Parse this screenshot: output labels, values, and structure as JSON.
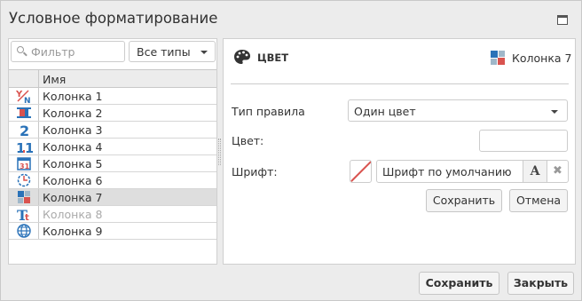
{
  "dialog": {
    "title": "Условное форматирование",
    "save_label": "Сохранить",
    "close_label": "Закрыть"
  },
  "left": {
    "filter_placeholder": "Фильтр",
    "type_select_value": "Все типы",
    "column_header": "Имя",
    "columns": [
      {
        "label": "Колонка 1",
        "icon": "text-yn-icon"
      },
      {
        "label": "Колонка 2",
        "icon": "bar-column-icon"
      },
      {
        "label": "Колонка 3",
        "icon": "number-2-icon"
      },
      {
        "label": "Колонка 4",
        "icon": "decimal-icon"
      },
      {
        "label": "Колонка 5",
        "icon": "calendar-icon"
      },
      {
        "label": "Колонка 6",
        "icon": "clock-icon"
      },
      {
        "label": "Колонка 7",
        "icon": "color-grid-icon",
        "selected": true
      },
      {
        "label": "Колонка 8",
        "icon": "text-type-icon",
        "disabled": true
      },
      {
        "label": "Колонка 9",
        "icon": "globe-icon"
      }
    ]
  },
  "right": {
    "header_title": "ЦВЕТ",
    "header_column": "Колонка 7",
    "rule_type_label": "Тип правила",
    "rule_type_value": "Один цвет",
    "color_label": "Цвет:",
    "color_value": "",
    "font_label": "Шрифт:",
    "font_value": "Шрифт по умолчанию",
    "font_button_letter": "A",
    "save_label": "Сохранить",
    "cancel_label": "Отмена"
  },
  "colors": {
    "accent_red": "#d9534f",
    "accent_blue": "#2a72b8",
    "selected_row": "#dedede"
  }
}
